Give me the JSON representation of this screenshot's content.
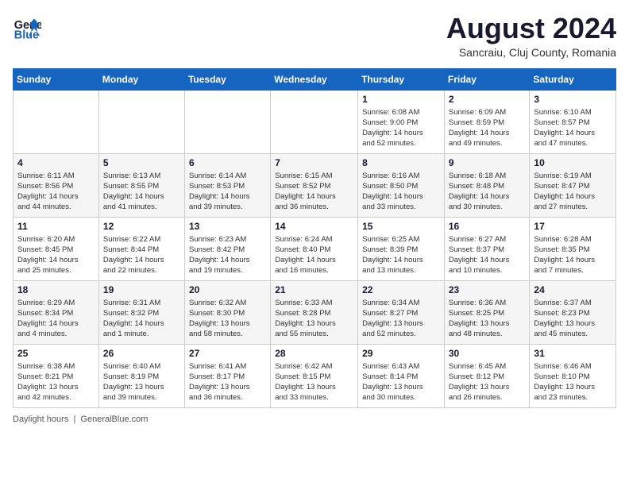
{
  "header": {
    "logo_line1": "General",
    "logo_line2": "Blue",
    "month_title": "August 2024",
    "subtitle": "Sancraiu, Cluj County, Romania"
  },
  "days_of_week": [
    "Sunday",
    "Monday",
    "Tuesday",
    "Wednesday",
    "Thursday",
    "Friday",
    "Saturday"
  ],
  "weeks": [
    [
      {
        "num": "",
        "info": ""
      },
      {
        "num": "",
        "info": ""
      },
      {
        "num": "",
        "info": ""
      },
      {
        "num": "",
        "info": ""
      },
      {
        "num": "1",
        "info": "Sunrise: 6:08 AM\nSunset: 9:00 PM\nDaylight: 14 hours\nand 52 minutes."
      },
      {
        "num": "2",
        "info": "Sunrise: 6:09 AM\nSunset: 8:59 PM\nDaylight: 14 hours\nand 49 minutes."
      },
      {
        "num": "3",
        "info": "Sunrise: 6:10 AM\nSunset: 8:57 PM\nDaylight: 14 hours\nand 47 minutes."
      }
    ],
    [
      {
        "num": "4",
        "info": "Sunrise: 6:11 AM\nSunset: 8:56 PM\nDaylight: 14 hours\nand 44 minutes."
      },
      {
        "num": "5",
        "info": "Sunrise: 6:13 AM\nSunset: 8:55 PM\nDaylight: 14 hours\nand 41 minutes."
      },
      {
        "num": "6",
        "info": "Sunrise: 6:14 AM\nSunset: 8:53 PM\nDaylight: 14 hours\nand 39 minutes."
      },
      {
        "num": "7",
        "info": "Sunrise: 6:15 AM\nSunset: 8:52 PM\nDaylight: 14 hours\nand 36 minutes."
      },
      {
        "num": "8",
        "info": "Sunrise: 6:16 AM\nSunset: 8:50 PM\nDaylight: 14 hours\nand 33 minutes."
      },
      {
        "num": "9",
        "info": "Sunrise: 6:18 AM\nSunset: 8:48 PM\nDaylight: 14 hours\nand 30 minutes."
      },
      {
        "num": "10",
        "info": "Sunrise: 6:19 AM\nSunset: 8:47 PM\nDaylight: 14 hours\nand 27 minutes."
      }
    ],
    [
      {
        "num": "11",
        "info": "Sunrise: 6:20 AM\nSunset: 8:45 PM\nDaylight: 14 hours\nand 25 minutes."
      },
      {
        "num": "12",
        "info": "Sunrise: 6:22 AM\nSunset: 8:44 PM\nDaylight: 14 hours\nand 22 minutes."
      },
      {
        "num": "13",
        "info": "Sunrise: 6:23 AM\nSunset: 8:42 PM\nDaylight: 14 hours\nand 19 minutes."
      },
      {
        "num": "14",
        "info": "Sunrise: 6:24 AM\nSunset: 8:40 PM\nDaylight: 14 hours\nand 16 minutes."
      },
      {
        "num": "15",
        "info": "Sunrise: 6:25 AM\nSunset: 8:39 PM\nDaylight: 14 hours\nand 13 minutes."
      },
      {
        "num": "16",
        "info": "Sunrise: 6:27 AM\nSunset: 8:37 PM\nDaylight: 14 hours\nand 10 minutes."
      },
      {
        "num": "17",
        "info": "Sunrise: 6:28 AM\nSunset: 8:35 PM\nDaylight: 14 hours\nand 7 minutes."
      }
    ],
    [
      {
        "num": "18",
        "info": "Sunrise: 6:29 AM\nSunset: 8:34 PM\nDaylight: 14 hours\nand 4 minutes."
      },
      {
        "num": "19",
        "info": "Sunrise: 6:31 AM\nSunset: 8:32 PM\nDaylight: 14 hours\nand 1 minute."
      },
      {
        "num": "20",
        "info": "Sunrise: 6:32 AM\nSunset: 8:30 PM\nDaylight: 13 hours\nand 58 minutes."
      },
      {
        "num": "21",
        "info": "Sunrise: 6:33 AM\nSunset: 8:28 PM\nDaylight: 13 hours\nand 55 minutes."
      },
      {
        "num": "22",
        "info": "Sunrise: 6:34 AM\nSunset: 8:27 PM\nDaylight: 13 hours\nand 52 minutes."
      },
      {
        "num": "23",
        "info": "Sunrise: 6:36 AM\nSunset: 8:25 PM\nDaylight: 13 hours\nand 48 minutes."
      },
      {
        "num": "24",
        "info": "Sunrise: 6:37 AM\nSunset: 8:23 PM\nDaylight: 13 hours\nand 45 minutes."
      }
    ],
    [
      {
        "num": "25",
        "info": "Sunrise: 6:38 AM\nSunset: 8:21 PM\nDaylight: 13 hours\nand 42 minutes."
      },
      {
        "num": "26",
        "info": "Sunrise: 6:40 AM\nSunset: 8:19 PM\nDaylight: 13 hours\nand 39 minutes."
      },
      {
        "num": "27",
        "info": "Sunrise: 6:41 AM\nSunset: 8:17 PM\nDaylight: 13 hours\nand 36 minutes."
      },
      {
        "num": "28",
        "info": "Sunrise: 6:42 AM\nSunset: 8:15 PM\nDaylight: 13 hours\nand 33 minutes."
      },
      {
        "num": "29",
        "info": "Sunrise: 6:43 AM\nSunset: 8:14 PM\nDaylight: 13 hours\nand 30 minutes."
      },
      {
        "num": "30",
        "info": "Sunrise: 6:45 AM\nSunset: 8:12 PM\nDaylight: 13 hours\nand 26 minutes."
      },
      {
        "num": "31",
        "info": "Sunrise: 6:46 AM\nSunset: 8:10 PM\nDaylight: 13 hours\nand 23 minutes."
      }
    ]
  ],
  "footer": {
    "daylight_hours_label": "Daylight hours",
    "source": "GeneralBlue.com"
  }
}
